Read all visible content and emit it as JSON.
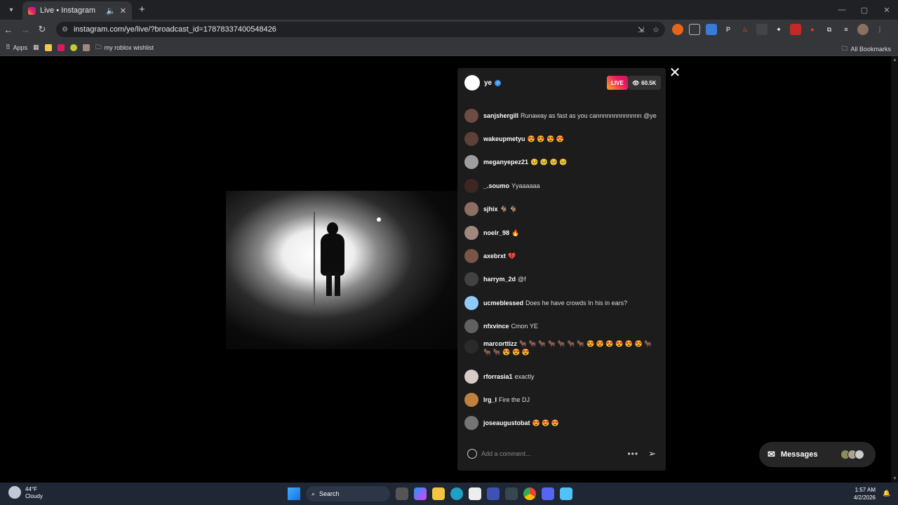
{
  "browser": {
    "tab_title": "Live • Instagram",
    "url": "instagram.com/ye/live/?broadcast_id=17878337400548426",
    "bookmarks": [
      {
        "label": "Apps"
      },
      {
        "label": ""
      },
      {
        "label": ""
      },
      {
        "label": ""
      },
      {
        "label": ""
      },
      {
        "label": "my roblox wishlist"
      }
    ],
    "all_bookmarks": "All Bookmarks"
  },
  "live": {
    "host": "ye",
    "live_label": "LIVE",
    "viewers": "60.5K",
    "comments": [
      {
        "user": "sanjshergill",
        "text": "Runaway as fast as you cannnnnnnnnnnnn @ye"
      },
      {
        "user": "wakeupmetyu",
        "text": "😍 😍 😍 😍"
      },
      {
        "user": "meganyepez21",
        "text": "🥺 🥺 🥺 🥺"
      },
      {
        "user": "_.soumo",
        "text": "Yyaaaaaa"
      },
      {
        "user": "sjhix",
        "text": "🐐 🐐"
      },
      {
        "user": "noelr_98",
        "text": "🔥"
      },
      {
        "user": "axebrxt",
        "text": "💔"
      },
      {
        "user": "harrym_2d",
        "text": "@f"
      },
      {
        "user": "ucmeblessed",
        "text": "Does he have crowds In his in ears?"
      },
      {
        "user": "nfxvince",
        "text": "Cmon YE"
      },
      {
        "user": "marcorttizz",
        "text": "🐂 🐂 🐂 🐂 🐂 🐂 🐂 😍 😍 😍 😍 😍 😍 🐂 🐂 🐂 😍 😍 😍"
      },
      {
        "user": "rforrasia1",
        "text": "exactly"
      },
      {
        "user": "lrg_l",
        "text": "Fire the DJ"
      },
      {
        "user": "joseaugustobat",
        "text": "😍 😍 😍"
      }
    ],
    "comment_placeholder": "Add a comment..."
  },
  "messages": {
    "label": "Messages"
  },
  "taskbar": {
    "temperature": "44°F",
    "weather": "Cloudy",
    "search_label": "Search",
    "time": "1:57 AM",
    "date": "4/2/2026"
  },
  "colors": {
    "live_gradient": [
      "#f9a825",
      "#e91e63"
    ],
    "verified": "#3897f0",
    "panel_bg": "#1c1c1d"
  }
}
